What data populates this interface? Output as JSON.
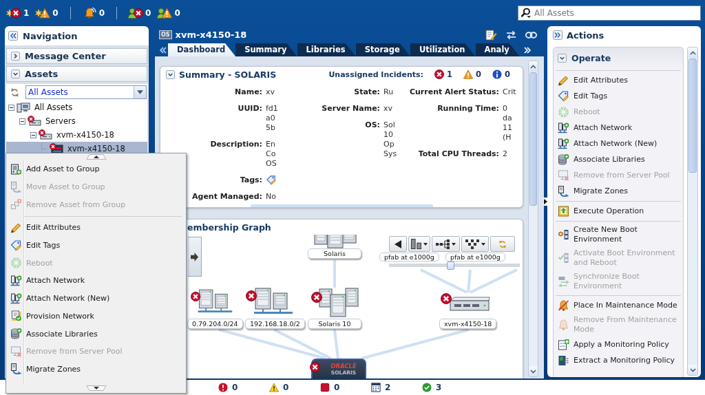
{
  "top_bar": {
    "counter_groups": [
      [
        {
          "kind": "incident-critical",
          "count": "1"
        },
        {
          "kind": "incident-warning",
          "count": "0"
        }
      ],
      [
        {
          "kind": "alarm",
          "count": "0"
        }
      ],
      [
        {
          "kind": "user-critical",
          "count": "0"
        },
        {
          "kind": "user-warning",
          "count": "0"
        }
      ]
    ],
    "search": {
      "placeholder": "All Assets"
    }
  },
  "navigation": {
    "title": "Navigation",
    "sections": [
      {
        "title": "Message Center",
        "expanded": false
      },
      {
        "title": "Assets",
        "expanded": true,
        "filter": {
          "value": "All Assets"
        },
        "tree": [
          {
            "label": "All Assets",
            "kind": "root",
            "critical": false,
            "expanded": true,
            "selected": false,
            "children": [
              {
                "label": "Servers",
                "kind": "servers",
                "critical": true,
                "expanded": true,
                "selected": false,
                "children": [
                  {
                    "label": "xvm-x4150-18",
                    "kind": "server",
                    "critical": true,
                    "expanded": true,
                    "selected": false,
                    "children": [
                      {
                        "label": "xvm-x4150-18",
                        "kind": "os",
                        "critical": true,
                        "selected": true
                      }
                    ]
                  }
                ]
              }
            ]
          }
        ]
      }
    ]
  },
  "asset": {
    "type_badge": "OS",
    "title": "xvm-x4150-18",
    "tabs": [
      {
        "label": "Dashboard",
        "selected": true
      },
      {
        "label": "Summary",
        "selected": false
      },
      {
        "label": "Libraries",
        "selected": false
      },
      {
        "label": "Storage",
        "selected": false
      },
      {
        "label": "Utilization",
        "selected": false
      },
      {
        "label": "Analy",
        "selected": false
      }
    ],
    "summary": {
      "title": "Summary - SOLARIS",
      "expanded": true,
      "incidents_label": "Unassigned Incidents:",
      "incidents": [
        {
          "kind": "critical",
          "count": "1"
        },
        {
          "kind": "warning",
          "count": "0"
        },
        {
          "kind": "info",
          "count": "0"
        }
      ],
      "columns": [
        [
          {
            "kind": "text",
            "label": "Name:",
            "value": [
              "xv"
            ]
          },
          {
            "kind": "text",
            "label": "UUID:",
            "value": [
              "fd1",
              "a0",
              "5b"
            ]
          },
          {
            "kind": "text",
            "label": "Description:",
            "value": [
              "En",
              "Co",
              "OS"
            ]
          },
          {
            "kind": "tags",
            "label": "Tags:"
          },
          {
            "kind": "text",
            "label": "Agent Managed:",
            "value": [
              "No"
            ]
          }
        ],
        [
          {
            "kind": "text",
            "label": "State:",
            "value": [
              "Ru"
            ]
          },
          {
            "kind": "text",
            "label": "Server Name:",
            "value": [
              "xv"
            ]
          },
          {
            "kind": "text",
            "label": "OS:",
            "value": [
              "Sol",
              "10",
              "Op",
              "Sys"
            ]
          }
        ],
        [
          {
            "kind": "text",
            "label": "Current Alert Status:",
            "value": [
              "Crit"
            ]
          },
          {
            "kind": "text",
            "label": "Running Time:",
            "value": [
              "0",
              "da",
              "11",
              "(H"
            ]
          },
          {
            "kind": "text",
            "label": "Total CPU Threads:",
            "value": [
              "2"
            ]
          }
        ]
      ]
    },
    "membership_graph": {
      "title": "embership Graph",
      "nodes": [
        {
          "kind": "os",
          "label": "Solaris"
        },
        {
          "kind": "interface",
          "label": "pfab at e1000g"
        },
        {
          "kind": "interface",
          "label": "pfab at e1000g"
        },
        {
          "kind": "network",
          "label": "0.79.204.0/24",
          "critical": true
        },
        {
          "kind": "network",
          "label": "192.168.18.0/2",
          "critical": true
        },
        {
          "kind": "os-group",
          "label": "Solaris 10",
          "critical": true
        },
        {
          "kind": "server",
          "label": "xvm-x4150-18",
          "critical": true
        },
        {
          "kind": "chassis",
          "screen_text": [
            "ORACLE",
            "SOLARIS"
          ],
          "critical": true
        }
      ],
      "zoom": {
        "level": 0.47
      }
    }
  },
  "actions": {
    "title": "Actions",
    "section": {
      "title": "Operate",
      "expanded": true,
      "groups": [
        [
          {
            "label": "Edit Attributes",
            "kind": "edit",
            "disabled": false
          },
          {
            "label": "Edit Tags",
            "kind": "tag",
            "disabled": false
          },
          {
            "label": "Reboot",
            "kind": "reboot",
            "disabled": true
          },
          {
            "label": "Attach Network",
            "kind": "network",
            "disabled": false
          },
          {
            "label": "Attach Network (New)",
            "kind": "network",
            "disabled": false
          },
          {
            "label": "Associate Libraries",
            "kind": "library",
            "disabled": false
          },
          {
            "label": "Remove from Server Pool",
            "kind": "remove-pool",
            "disabled": true
          },
          {
            "label": "Migrate Zones",
            "kind": "migrate",
            "disabled": false
          }
        ],
        [
          {
            "label": "Execute Operation",
            "kind": "execute",
            "disabled": false
          }
        ],
        [
          {
            "label": "Create New Boot Environment",
            "kind": "boot-new",
            "disabled": false
          },
          {
            "label": "Activate Boot Environment and Reboot",
            "kind": "boot-activate",
            "disabled": true
          },
          {
            "label": "Synchronize Boot Environment",
            "kind": "boot-sync",
            "disabled": true
          }
        ],
        [
          {
            "label": "Place In Maintenance Mode",
            "kind": "maintenance-on",
            "disabled": false
          },
          {
            "label": "Remove From Maintenance Mode",
            "kind": "maintenance-off",
            "disabled": true
          },
          {
            "label": "Apply a Monitoring Policy",
            "kind": "policy-apply",
            "disabled": false
          },
          {
            "label": "Extract a Monitoring Policy",
            "kind": "policy-extract",
            "disabled": false
          }
        ]
      ]
    }
  },
  "context_menu": {
    "groups": [
      [
        {
          "label": "Add Asset to Group",
          "kind": "add-group",
          "disabled": false
        },
        {
          "label": "Move Asset to Group",
          "kind": "move-group",
          "disabled": true
        },
        {
          "label": "Remove Asset from Group",
          "kind": "remove-group",
          "disabled": true
        }
      ],
      [
        {
          "label": "Edit Attributes",
          "kind": "edit",
          "disabled": false
        },
        {
          "label": "Edit Tags",
          "kind": "tag",
          "disabled": false
        },
        {
          "label": "Reboot",
          "kind": "reboot",
          "disabled": true
        },
        {
          "label": "Attach Network",
          "kind": "network",
          "disabled": false
        },
        {
          "label": "Attach Network (New)",
          "kind": "network",
          "disabled": false
        },
        {
          "label": "Provision Network",
          "kind": "provision",
          "disabled": false
        },
        {
          "label": "Associate Libraries",
          "kind": "library",
          "disabled": false
        },
        {
          "label": "Remove from Server Pool",
          "kind": "remove-pool",
          "disabled": true
        },
        {
          "label": "Migrate Zones",
          "kind": "migrate",
          "disabled": false
        }
      ]
    ]
  },
  "status_bar": {
    "counters": [
      {
        "kind": "critical",
        "count": "0"
      },
      {
        "kind": "warning",
        "count": "0"
      },
      {
        "kind": "stopped",
        "count": "0"
      },
      {
        "kind": "scheduled",
        "count": "2"
      },
      {
        "kind": "ok",
        "count": "3"
      }
    ]
  }
}
